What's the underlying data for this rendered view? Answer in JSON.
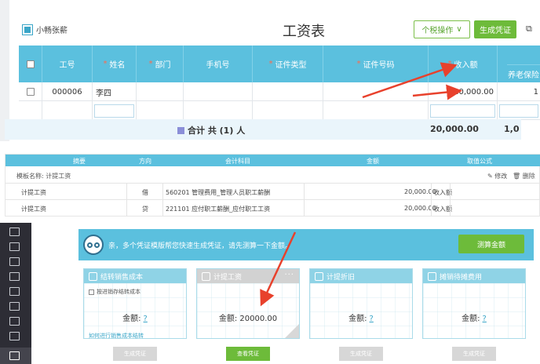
{
  "panel1": {
    "brand": "小畅张薪",
    "title": "工资表",
    "tax_button": "个税操作",
    "tax_chevron": "∨",
    "generate_button": "生成凭证",
    "more_icon": "⧉",
    "columns": [
      "工号",
      "姓名",
      "部门",
      "手机号",
      "证件类型",
      "证件号码",
      "收入额"
    ],
    "required_mark": "*",
    "sub_header": "养老保险",
    "row": {
      "id": "000006",
      "name": "李四",
      "income": "20,000.00",
      "next": "1"
    },
    "total_label": "合计 共 (1) 人",
    "total_amount": "20,000.00",
    "total_next": "1,0"
  },
  "panel2": {
    "headers": [
      "摘要",
      "方向",
      "会计科目",
      "金额",
      "取值公式"
    ],
    "template_name": "模板名称: 计提工资",
    "edit_label": "修改",
    "delete_label": "删除",
    "rows": [
      {
        "summary": "计提工资",
        "direction": "借",
        "account": "560201 管理费用_管理人员职工薪酬",
        "amount": "20,000.00",
        "formula": "收入额"
      },
      {
        "summary": "计提工资",
        "direction": "贷",
        "account": "221101 应付职工薪酬_应付职工工资",
        "amount": "20,000.00",
        "formula": "收入额"
      }
    ]
  },
  "panel3": {
    "message": "亲，多个凭证模版帮您快速生成凭证，请先测算一下金额。",
    "calc_button": "测算金额",
    "cards": [
      {
        "title": "结转销售成本",
        "option": "按进销存结转成本",
        "amount_label": "金额:",
        "amount": "?",
        "link": "如何进行销售成本结转",
        "button": "生成凭证"
      },
      {
        "title": "计提工资",
        "more": "···",
        "amount_label": "金额:",
        "amount": "20000.00",
        "button": "查看凭证"
      },
      {
        "title": "计提折旧",
        "amount_label": "金额:",
        "amount": "?",
        "button": "生成凭证"
      },
      {
        "title": "摊销待摊费用",
        "amount_label": "金额:",
        "amount": "?",
        "button": "生成凭证"
      }
    ]
  },
  "colors": {
    "header": "#5bc0de",
    "green": "#6dbb3a",
    "arrow": "#e8412c",
    "sidebar": "#2d2d35"
  }
}
